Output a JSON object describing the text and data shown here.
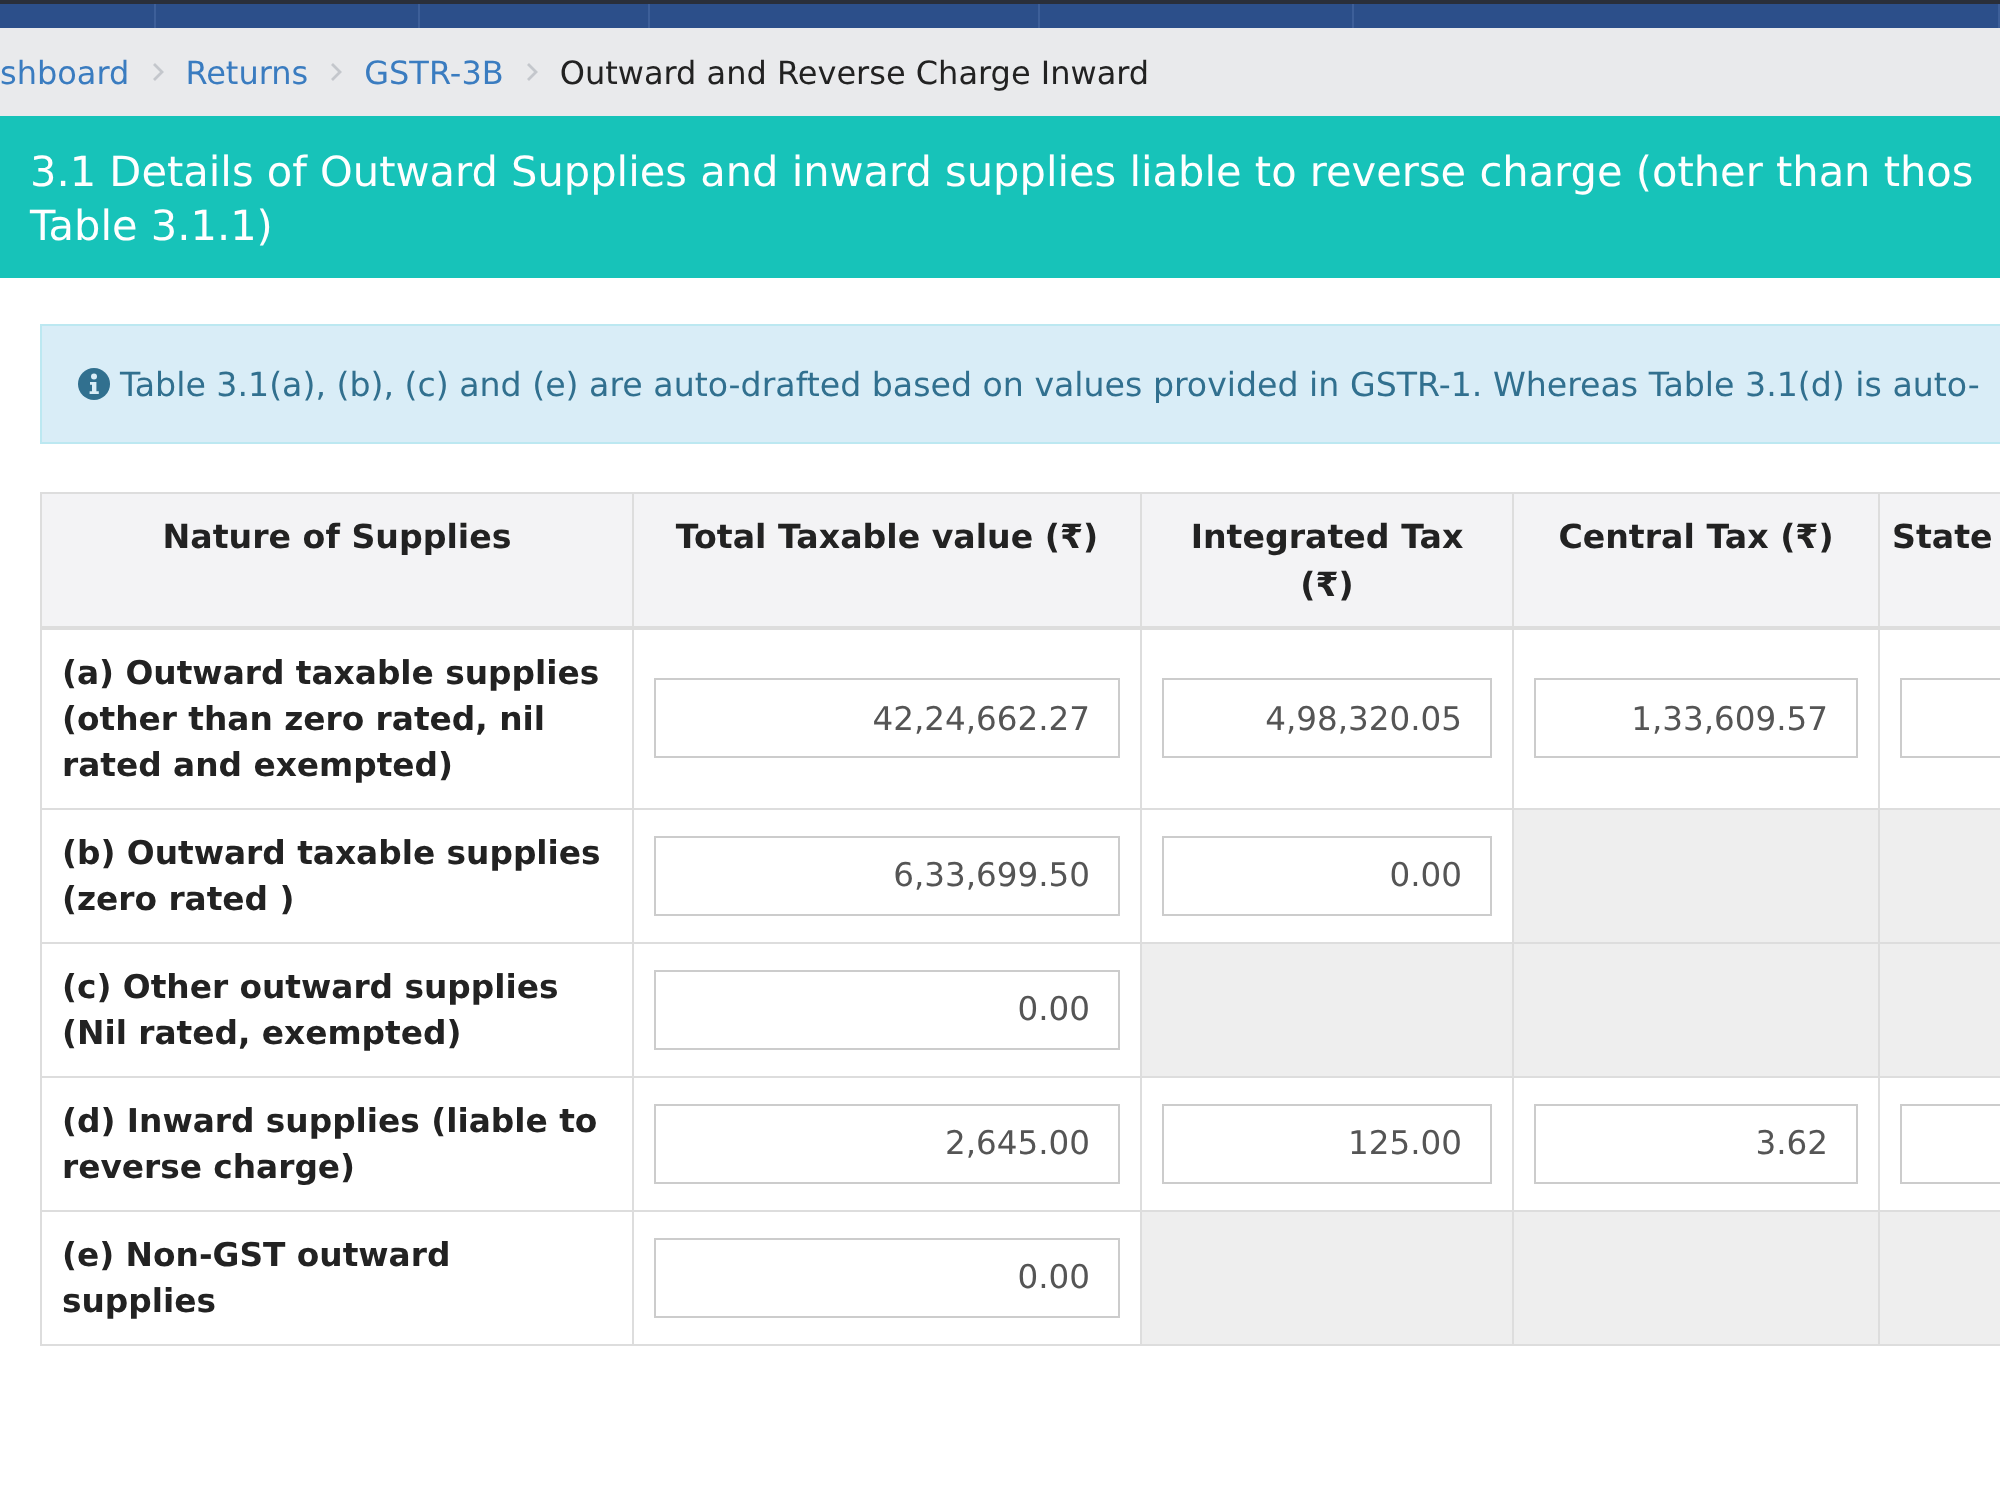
{
  "breadcrumb": [
    {
      "label": "shboard",
      "kind": "link"
    },
    {
      "label": "Returns",
      "kind": "link"
    },
    {
      "label": "GSTR-3B",
      "kind": "link"
    },
    {
      "label": "Outward and Reverse Charge Inward",
      "kind": "current"
    }
  ],
  "section_header": {
    "lines": [
      "3.1 Details of Outward Supplies and inward supplies liable to reverse charge (other than thos",
      "Table 3.1.1)"
    ]
  },
  "info_alert": {
    "text": "Table 3.1(a), (b), (c) and (e) are auto-drafted based on values provided in GSTR-1. Whereas Table 3.1(d) is auto-"
  },
  "table": {
    "columns": [
      "Nature of Supplies",
      "Total Taxable value (₹)",
      "Integrated Tax (₹)",
      "Central Tax (₹)",
      "State"
    ],
    "rows": [
      {
        "cells": [
          {
            "kind": "label",
            "text": "(a) Outward taxable supplies (other than zero rated, nil rated and exempted)"
          },
          {
            "kind": "input",
            "value": "42,24,662.27"
          },
          {
            "kind": "input",
            "value": "4,98,320.05"
          },
          {
            "kind": "input",
            "value": "1,33,609.57"
          },
          {
            "kind": "input"
          }
        ]
      },
      {
        "cells": [
          {
            "kind": "label",
            "text": "(b) Outward taxable supplies (zero rated )"
          },
          {
            "kind": "input",
            "value": "6,33,699.50"
          },
          {
            "kind": "input",
            "value": "0.00"
          },
          {
            "kind": "disabled"
          },
          {
            "kind": "disabled"
          }
        ]
      },
      {
        "cells": [
          {
            "kind": "label",
            "text": "(c) Other outward supplies (Nil rated, exempted)"
          },
          {
            "kind": "input",
            "value": "0.00"
          },
          {
            "kind": "disabled"
          },
          {
            "kind": "disabled"
          },
          {
            "kind": "disabled"
          }
        ]
      },
      {
        "cells": [
          {
            "kind": "label",
            "text": "(d) Inward supplies (liable to reverse charge)"
          },
          {
            "kind": "input",
            "value": "2,645.00"
          },
          {
            "kind": "input",
            "value": "125.00"
          },
          {
            "kind": "input",
            "value": "3.62"
          },
          {
            "kind": "input"
          }
        ]
      },
      {
        "cells": [
          {
            "kind": "label",
            "text": "(e) Non-GST outward supplies"
          },
          {
            "kind": "input",
            "value": "0.00"
          },
          {
            "kind": "disabled"
          },
          {
            "kind": "disabled"
          },
          {
            "kind": "disabled"
          }
        ]
      }
    ]
  }
}
